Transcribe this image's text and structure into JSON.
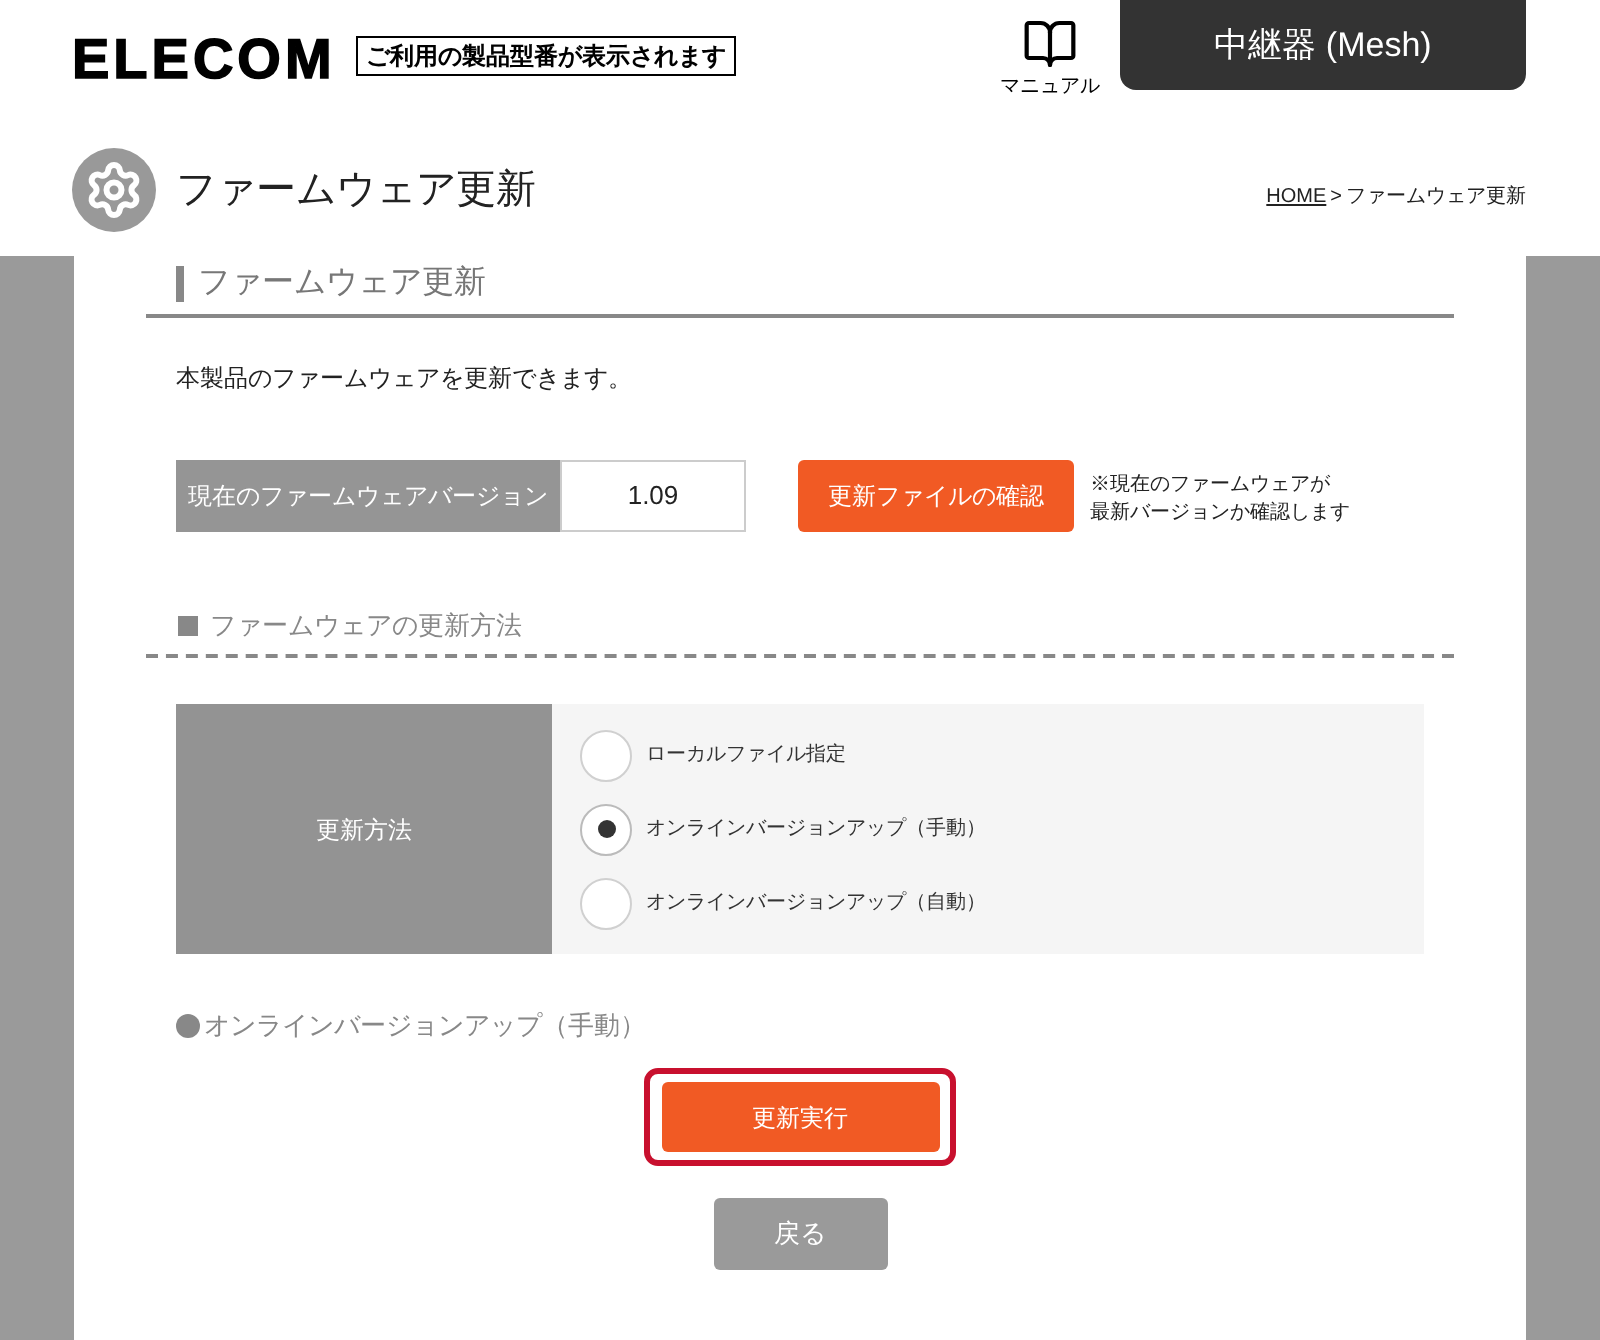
{
  "header": {
    "logo": "ELECOM",
    "model_notice": "ご利用の製品型番が表示されます",
    "manual_label": "マニュアル",
    "device_tab": "中継器 (Mesh)"
  },
  "page_header": {
    "title": "ファームウェア更新",
    "breadcrumb": [
      {
        "label": "HOME",
        "kind": "link"
      },
      {
        "label": "ファームウェア更新",
        "kind": "current"
      }
    ],
    "separator": ">"
  },
  "section": {
    "heading": "ファームウェア更新",
    "description": "本製品のファームウェアを更新できます。"
  },
  "version": {
    "label": "現在のファームウェアバージョン",
    "value": "1.09",
    "check_button": "更新ファイルの確認",
    "note_lines": [
      "※現在のファームウェアが",
      "最新バージョンか確認します"
    ]
  },
  "method": {
    "heading": "ファームウェアの更新方法",
    "label": "更新方法",
    "options": [
      {
        "label": "ローカルファイル指定",
        "selected": false
      },
      {
        "label": "オンラインバージョンアップ（手動）",
        "selected": true
      },
      {
        "label": "オンラインバージョンアップ（自動）",
        "selected": false
      }
    ]
  },
  "selected_method": {
    "heading": "オンラインバージョンアップ（手動）"
  },
  "buttons": [
    {
      "label": "更新実行",
      "kind": "primary",
      "highlighted": true
    },
    {
      "label": "戻る",
      "kind": "secondary",
      "highlighted": false
    }
  ]
}
